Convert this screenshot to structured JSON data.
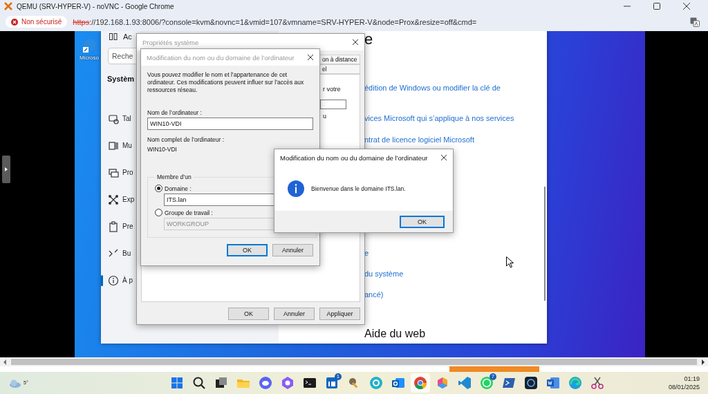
{
  "browser": {
    "title": "QEMU (SRV-HYPER-V) - noVNC - Google Chrome",
    "security_chip": "Non sécurisé",
    "url_scheme": "https",
    "url_rest": "://192.168.1.93:8006/?console=kvm&novnc=1&vmid=107&vmname=SRV-HYPER-V&node=Prox&resize=off&cmd="
  },
  "desktop_icons": [
    {
      "label": "Microso"
    }
  ],
  "settings_window": {
    "top_item": "Ac",
    "search_placeholder": "Reche",
    "section": "Systèm",
    "nav_items": [
      {
        "label": "Tal",
        "selected": false
      },
      {
        "label": "Mu",
        "selected": false
      },
      {
        "label": "Pro",
        "selected": false
      },
      {
        "label": "Exp",
        "selected": false
      },
      {
        "label": "Pre",
        "selected": false
      },
      {
        "label": "Bu",
        "selected": false
      },
      {
        "label": "À p",
        "selected": true
      }
    ],
    "heading": "e",
    "links": [
      "édition de Windows ou modifier la clé de",
      "vices Microsoft qui s’applique à nos services",
      "ntrat de licence logiciel Microsoft",
      "e",
      "du système",
      "ancé)"
    ],
    "help_heading": "Aide du web"
  },
  "system_properties": {
    "title": "Propriétés système",
    "tabs": [
      {
        "label": "on à distance"
      },
      {
        "label": "el"
      }
    ],
    "panel_texts": [
      "r votre",
      "u"
    ],
    "buttons": [
      {
        "label": "OK"
      },
      {
        "label": "Annuler"
      },
      {
        "label": "Appliquer"
      }
    ]
  },
  "rename_dialog": {
    "title": "Modification du nom ou du domaine de l’ordinateur",
    "active": false,
    "intro": "Vous pouvez modifier le nom et l’appartenance de cet ordinateur. Ces modifications peuvent influer sur l’accès aux ressources réseau.",
    "name_label": "Nom de l’ordinateur :",
    "name_value": "WIN10-VDI",
    "full_name_label": "Nom complet de l’ordinateur :",
    "full_name_value": "WIN10-VDI",
    "group_title": "Membre d’un",
    "options": [
      {
        "label": "Domaine :",
        "selected": true,
        "value": "ITS.lan"
      },
      {
        "label": "Groupe de travail :",
        "selected": false,
        "value": "WORKGROUP"
      }
    ],
    "buttons": [
      {
        "label": "OK",
        "default": true
      },
      {
        "label": "Annuler",
        "default": false
      }
    ]
  },
  "message_box": {
    "title": "Modification du nom ou du domaine de l’ordinateur",
    "active": true,
    "message": "Bienvenue dans le domaine ITS.lan.",
    "buttons": [
      {
        "label": "OK",
        "default": true
      }
    ]
  },
  "taskbar": {
    "weather": "5°",
    "apps": [
      {
        "kind": "start",
        "active": false
      },
      {
        "kind": "search",
        "active": false
      },
      {
        "kind": "task_view",
        "active": false
      },
      {
        "kind": "explorer",
        "active": false
      },
      {
        "kind": "discord",
        "active": false
      },
      {
        "kind": "copilot",
        "active": false
      },
      {
        "kind": "terminal",
        "active": false
      },
      {
        "kind": "linkedin",
        "active": false,
        "badge": "1"
      },
      {
        "kind": "tool",
        "active": false
      },
      {
        "kind": "canva",
        "active": false
      },
      {
        "kind": "outlook",
        "active": false
      },
      {
        "kind": "chrome",
        "active": true
      },
      {
        "kind": "m365",
        "active": false
      },
      {
        "kind": "vscode",
        "active": false
      },
      {
        "kind": "whatsapp",
        "active": false,
        "badge": "7"
      },
      {
        "kind": "powershell",
        "active": false
      },
      {
        "kind": "dark_app",
        "active": false
      },
      {
        "kind": "word",
        "active": false
      },
      {
        "kind": "edge",
        "active": false
      },
      {
        "kind": "snipping",
        "active": false
      }
    ],
    "time": "01:19",
    "date": "08/01/2025"
  }
}
